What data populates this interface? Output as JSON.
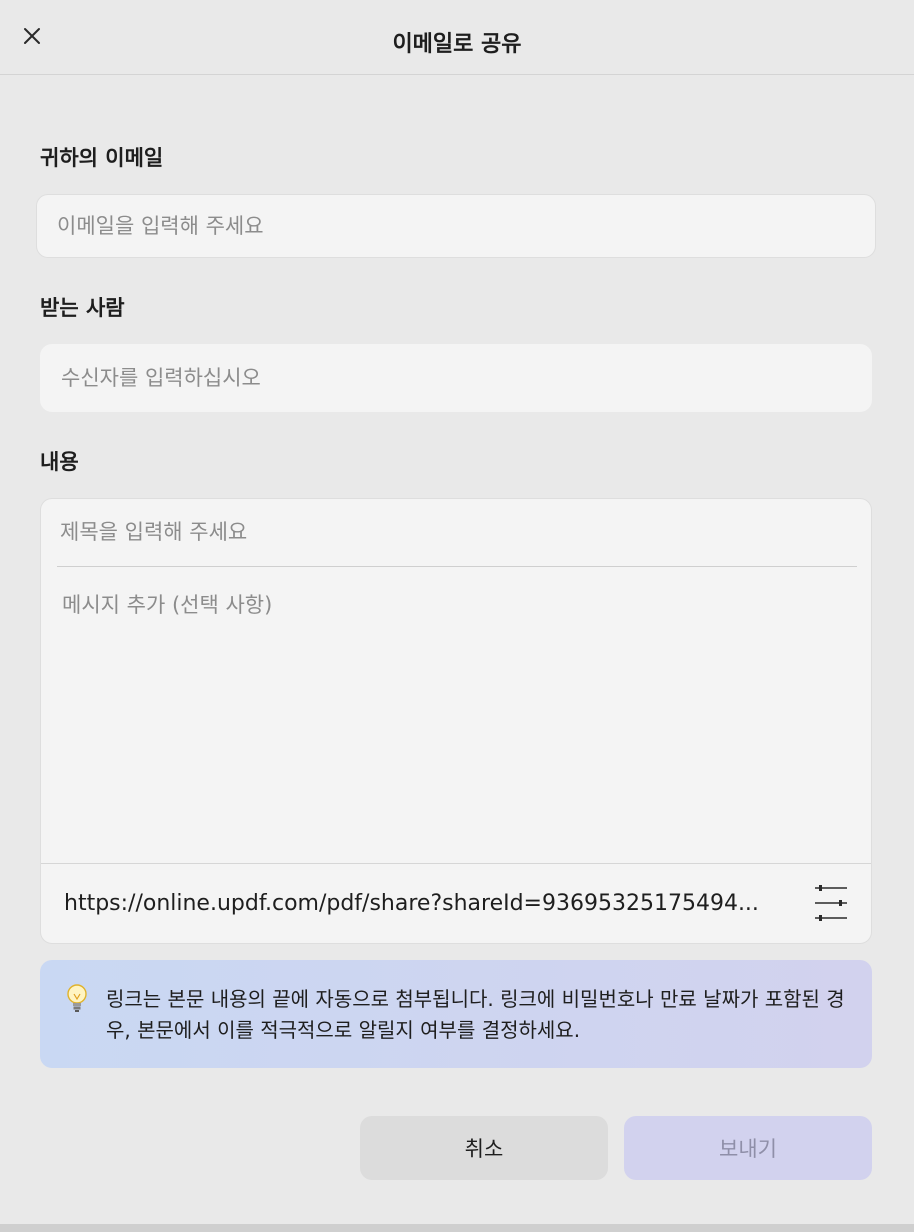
{
  "header": {
    "title": "이메일로 공유",
    "close_icon": "close-icon"
  },
  "your_email": {
    "label": "귀하의 이메일",
    "value": "",
    "placeholder": "이메일을 입력해 주세요"
  },
  "recipient": {
    "label": "받는 사람",
    "value": "",
    "placeholder": "수신자를 입력하십시오"
  },
  "content": {
    "label": "내용",
    "subject_placeholder": "제목을 입력해 주세요",
    "message_placeholder": "메시지 추가 (선택 사항)",
    "share_link": "https://online.updf.com/pdf/share?shareId=93695325175494...",
    "link_settings_icon": "sliders-icon"
  },
  "info": {
    "icon": "lightbulb-icon",
    "text": "링크는 본문 내용의 끝에 자동으로 첨부됩니다. 링크에 비밀번호나 만료 날짜가 포함된 경우, 본문에서 이를 적극적으로 알릴지 여부를 결정하세요."
  },
  "buttons": {
    "cancel_label": "취소",
    "send_label": "보내기"
  },
  "colors": {
    "background": "#e9e9e9",
    "field_background": "#f4f4f4",
    "info_gradient_start": "#c9d8f3",
    "info_gradient_end": "#d2d2ee",
    "send_button_disabled": "#d2d2ee"
  }
}
